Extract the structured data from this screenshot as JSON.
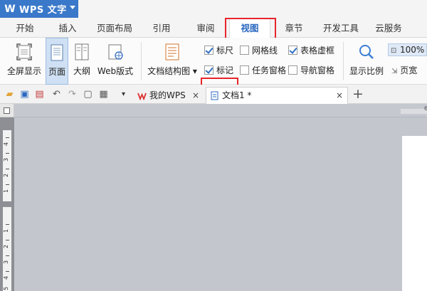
{
  "app": {
    "title": "WPS 文字"
  },
  "menu": {
    "tabs": [
      "开始",
      "插入",
      "页面布局",
      "引用",
      "审阅",
      "视图",
      "章节",
      "开发工具",
      "云服务"
    ],
    "active": "视图"
  },
  "ribbon": {
    "fullscreen": "全屏显示",
    "page": "页面",
    "outline": "大纲",
    "web": "Web版式",
    "doc_structure": "文档结构图",
    "ruler": "标尺",
    "marks": "标记",
    "gridlines": "网格线",
    "task_pane": "任务窗格",
    "table_gridlines": "表格虚框",
    "nav_pane": "导航窗格",
    "zoom_ratio": "显示比例",
    "zoom_value": "100%",
    "page_width": "页宽"
  },
  "checkboxes": {
    "ruler": true,
    "marks": true,
    "gridlines": false,
    "task_pane": false,
    "table_gridlines": true,
    "nav_pane": false
  },
  "doc_tabs": [
    {
      "label": "我的WPS",
      "close": "×"
    },
    {
      "label": "文档1 *",
      "close": "×"
    }
  ],
  "doc_tab_plus": "+",
  "ruler": {
    "h_number": "6",
    "v_numbers": [
      "4",
      "3",
      "2",
      "1",
      "1",
      "2",
      "3",
      "4",
      "5"
    ]
  },
  "colors": {
    "accent": "#2b68c0",
    "highlight": "#e8242b",
    "app_button": "#3a78c9"
  }
}
